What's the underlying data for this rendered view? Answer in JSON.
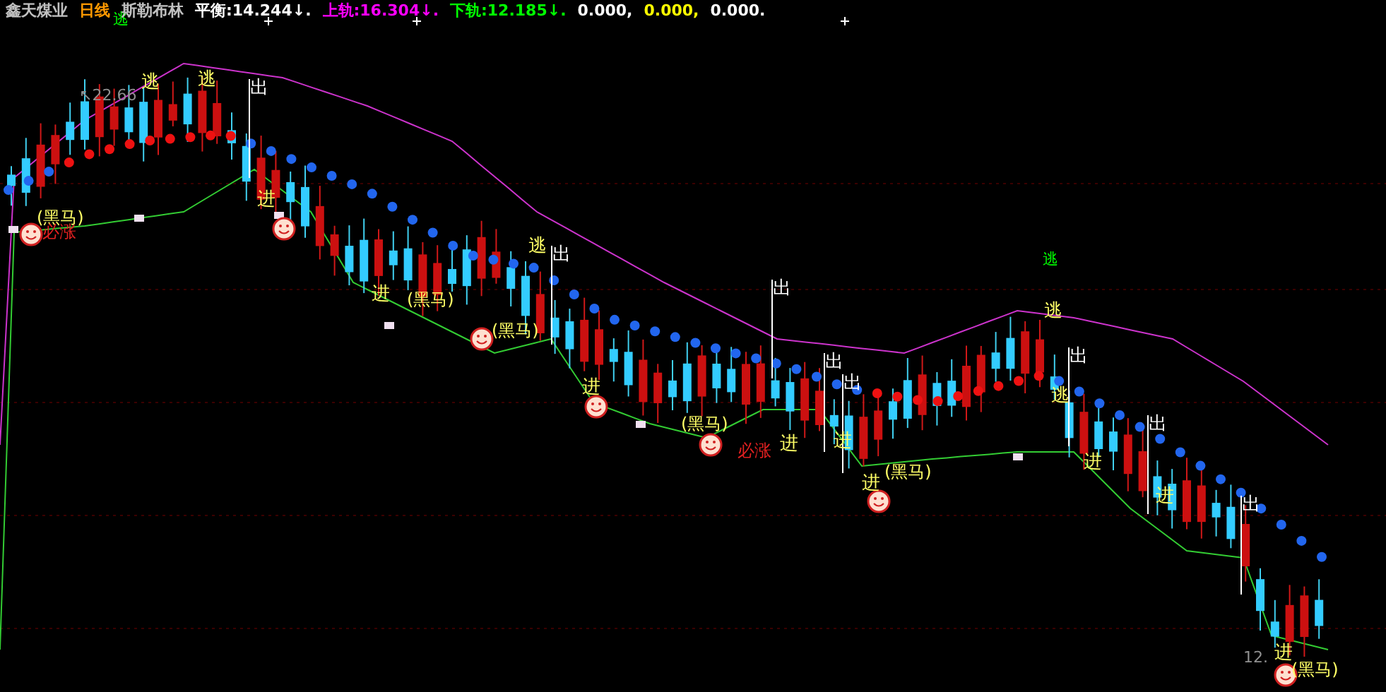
{
  "header": {
    "stock": "鑫天煤业",
    "period": "日线",
    "indicator": "斯勒布林",
    "readings": [
      {
        "label": "平衡:",
        "value": "14.244↓.",
        "color": "#ffffff"
      },
      {
        "label": "上轨:",
        "value": "16.304↓.",
        "color": "#ff00ff"
      },
      {
        "label": "下轨:",
        "value": "12.185↓.",
        "color": "#00ff00"
      },
      {
        "value": "0.000,",
        "color": "#ffffff"
      },
      {
        "value": "0.000,",
        "color": "#ffff00"
      },
      {
        "value": "0.000.",
        "color": "#ffffff"
      }
    ]
  },
  "chart": {
    "price_labels": [
      "↖22.66",
      "12."
    ],
    "signals": [
      {
        "kind": "escape-top",
        "text": "逃"
      },
      {
        "kind": "escape",
        "text": "逃"
      },
      {
        "kind": "escape",
        "text": "逃"
      },
      {
        "kind": "exit",
        "text": "出"
      },
      {
        "kind": "enter",
        "text": "进"
      },
      {
        "kind": "darkhorse",
        "text": "(黑马)"
      },
      {
        "kind": "surge",
        "text": "必涨"
      },
      {
        "kind": "enter",
        "text": "进"
      },
      {
        "kind": "darkhorse",
        "text": "(黑马)"
      },
      {
        "kind": "escape",
        "text": "逃"
      },
      {
        "kind": "exit",
        "text": "出"
      },
      {
        "kind": "darkhorse",
        "text": "(黑马)"
      },
      {
        "kind": "enter",
        "text": "进"
      },
      {
        "kind": "darkhorse",
        "text": "(黑马)"
      },
      {
        "kind": "surge",
        "text": "必涨"
      },
      {
        "kind": "enter",
        "text": "进"
      },
      {
        "kind": "exit",
        "text": "出"
      },
      {
        "kind": "exit",
        "text": "出"
      },
      {
        "kind": "exit",
        "text": "出"
      },
      {
        "kind": "enter",
        "text": "进"
      },
      {
        "kind": "enter",
        "text": "进"
      },
      {
        "kind": "darkhorse",
        "text": "(黑马)"
      },
      {
        "kind": "escape-top",
        "text": "逃"
      },
      {
        "kind": "escape",
        "text": "逃"
      },
      {
        "kind": "exit",
        "text": "出"
      },
      {
        "kind": "escape",
        "text": "逃"
      },
      {
        "kind": "enter",
        "text": "进"
      },
      {
        "kind": "exit",
        "text": "出"
      },
      {
        "kind": "enter",
        "text": "进"
      },
      {
        "kind": "exit",
        "text": "出"
      },
      {
        "kind": "enter",
        "text": "进"
      },
      {
        "kind": "darkhorse",
        "text": "(黑马)"
      }
    ]
  }
}
